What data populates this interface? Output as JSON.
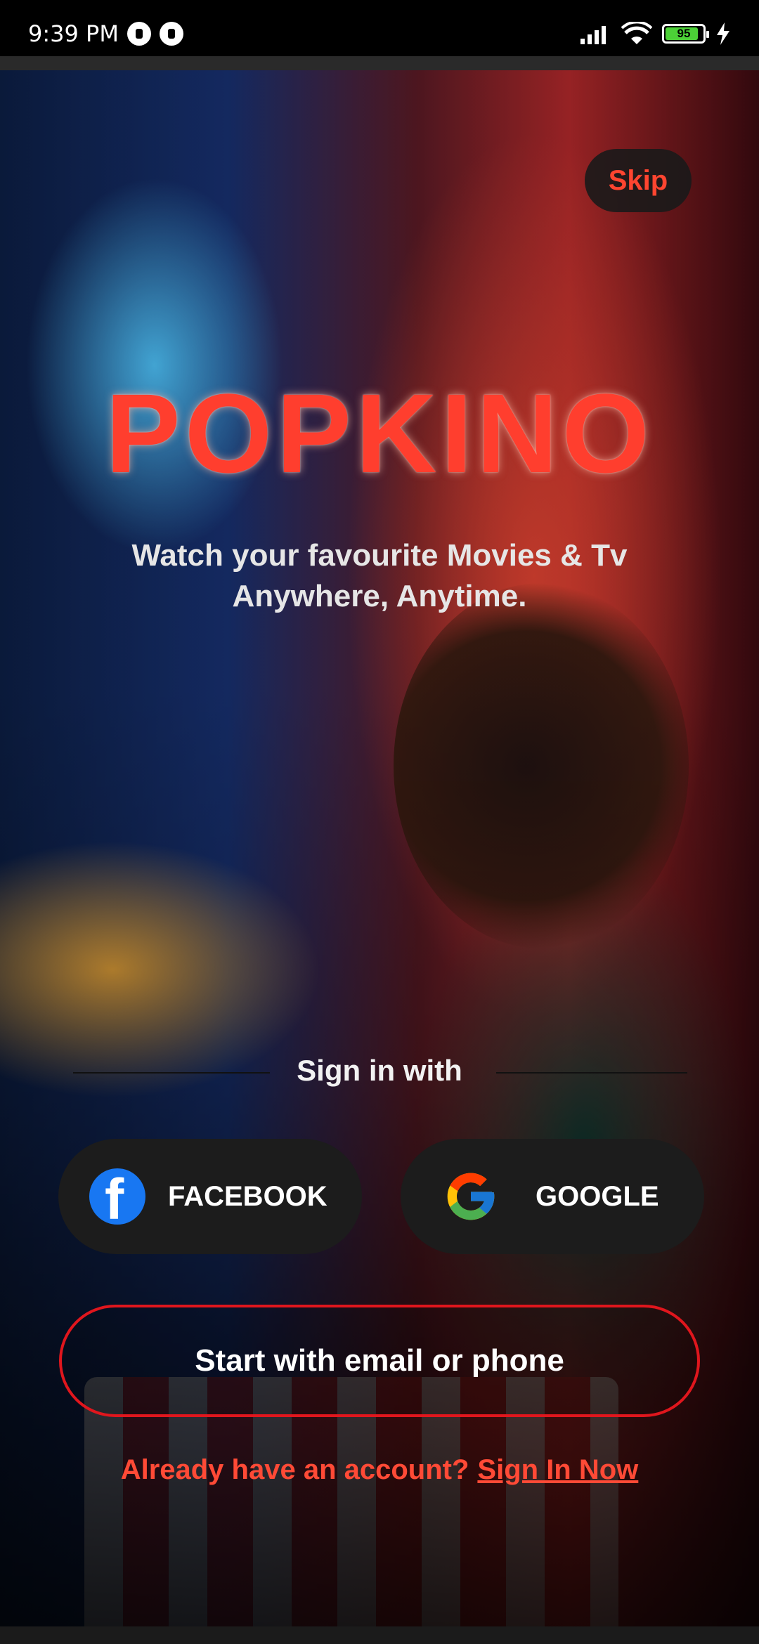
{
  "status_bar": {
    "time": "9:39 PM",
    "battery": "95"
  },
  "header": {
    "skip_label": "Skip"
  },
  "hero": {
    "title": "POPKINO",
    "tagline": "Watch your favourite Movies & Tv Anywhere, Anytime."
  },
  "signin": {
    "heading": "Sign in with",
    "facebook_label": "FACEBOOK",
    "google_label": "GOOGLE",
    "email_phone_label": "Start with email or phone"
  },
  "footer": {
    "prompt": "Already have an account?",
    "link": "Sign In Now"
  },
  "icons": {
    "facebook": "facebook-icon",
    "google": "google-icon",
    "signal": "signal-icon",
    "wifi": "wifi-icon",
    "battery": "battery-icon",
    "charging": "charging-icon"
  },
  "colors": {
    "accent": "#ff3e2e",
    "email_border": "#e0161d",
    "button_bg": "#1c1c1c",
    "facebook_blue": "#1877f2"
  }
}
